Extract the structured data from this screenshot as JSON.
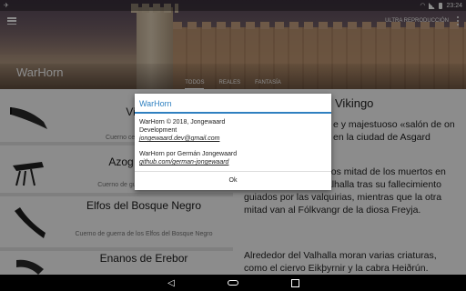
{
  "status_bar": {
    "time": "23:24"
  },
  "app_bar": {
    "ultra_label": "ULTRA REPRODUCCIÓN",
    "title": "WarHorn"
  },
  "tabs": [
    "TODOS",
    "REALES",
    "FANTASÍA"
  ],
  "list": [
    {
      "title": "Vikingo",
      "desc": "Cuerno ceremonial Vikingo"
    },
    {
      "title": "Azog de Moria",
      "desc": "Cuerno de guerra Azog de Moria"
    },
    {
      "title": "Elfos del Bosque Negro",
      "desc": "Cuerno de guerra de los Elfos del Bosque Negro"
    },
    {
      "title": "Enanos de Erebor",
      "desc": ""
    }
  ],
  "detail": {
    "title": "Vikingo",
    "p1": "e y majestuoso «salón de on en la ciudad de Asgard",
    "p2": "halla que solo oyen los mitad de los muertos en combate viajan al Valhalla tras su fallecimiento guiados por las valquirias, mientras que la otra mitad van al Fólkvangr de la diosa Freyja.",
    "p3": "Alrededor del Valhalla moran varias criaturas, como el ciervo Eikþyrnir y la cabra Heiðrún."
  },
  "dialog": {
    "title": "WarHorn",
    "line1": "WarHorn © 2018, Jongewaard",
    "line2": "Development",
    "email": "jongewaard.dev@gmail.com",
    "line3": "WarHorn por Germán Jongewaard",
    "github": "github.com/german-jongewaard",
    "ok": "Ok"
  },
  "icons": [
    "menu-icon",
    "overflow-icon",
    "wifi-icon",
    "signal-icon",
    "battery-icon",
    "back-icon",
    "home-icon",
    "recent-apps-icon",
    "horn-image"
  ]
}
